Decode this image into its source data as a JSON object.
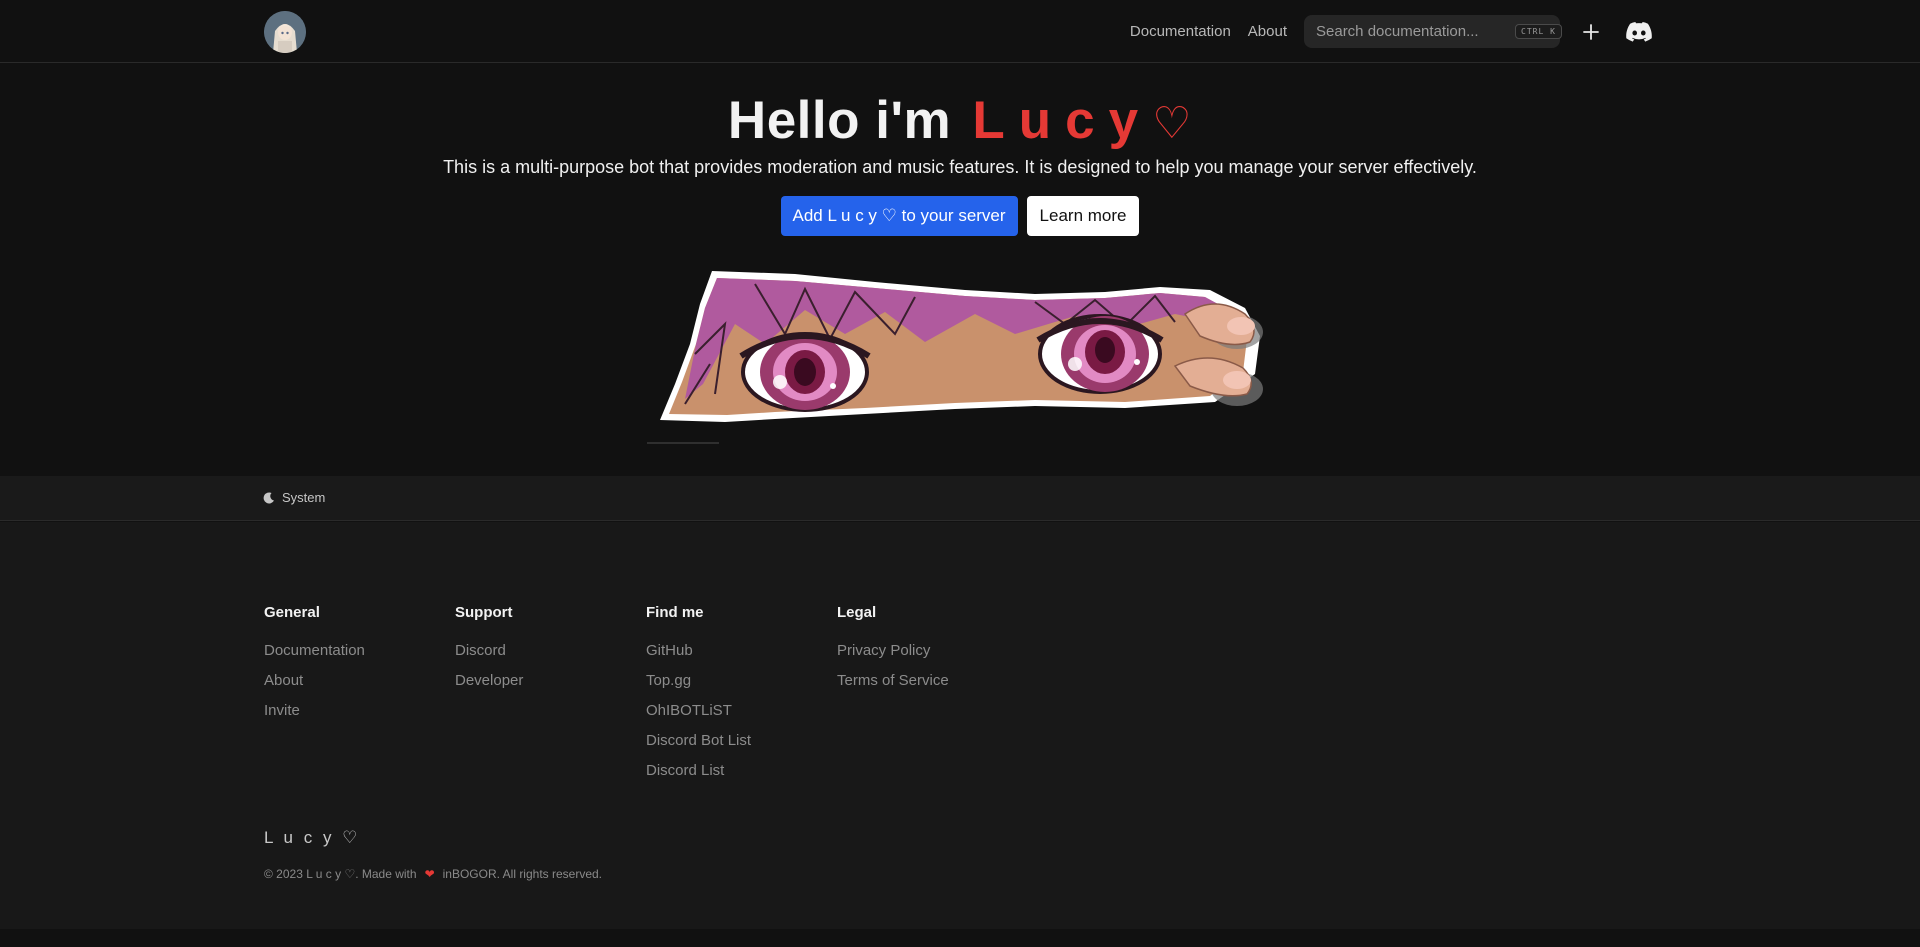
{
  "nav": {
    "links": [
      "Documentation",
      "About"
    ],
    "search_placeholder": "Search documentation...",
    "search_shortcut": "CTRL K",
    "add_icon": "plus-icon",
    "discord_icon": "discord-icon"
  },
  "hero": {
    "title_prefix": "Hello i'm",
    "title_brand": "Lucy",
    "title_heart": "♡",
    "description": "This is a multi-purpose bot that provides moderation and music features. It is designed to help you manage your server effectively.",
    "primary_button": "Add L u c y ♡ to your server",
    "secondary_button": "Learn more",
    "image": "anime-eyes-peek-image"
  },
  "theme": {
    "label": "System",
    "icon": "moon-icon"
  },
  "footer": {
    "columns": [
      {
        "title": "General",
        "links": [
          "Documentation",
          "About",
          "Invite"
        ]
      },
      {
        "title": "Support",
        "links": [
          "Discord",
          "Developer"
        ]
      },
      {
        "title": "Find me",
        "links": [
          "GitHub",
          "Top.gg",
          "OhIBOTLiST",
          "Discord Bot List",
          "Discord List"
        ]
      },
      {
        "title": "Legal",
        "links": [
          "Privacy Policy",
          "Terms of Service"
        ]
      }
    ],
    "brand": "L u c y ♡",
    "copyright_prefix": "© 2023 L u c y ♡. Made with",
    "copyright_heart": "❤",
    "copyright_suffix": "inBOGOR. All rights reserved."
  },
  "colors": {
    "background": "#111111",
    "accent_red": "#e53935",
    "primary_blue": "#2563eb",
    "footer_bg": "#181818"
  }
}
